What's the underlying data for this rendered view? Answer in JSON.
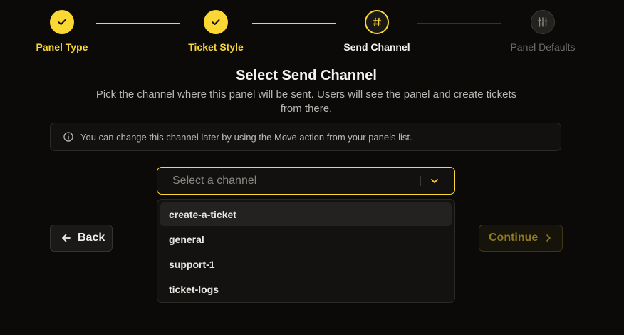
{
  "stepper": {
    "steps": [
      {
        "label": "Panel Type",
        "state": "done",
        "icon": "check-icon"
      },
      {
        "label": "Ticket Style",
        "state": "done",
        "icon": "check-icon"
      },
      {
        "label": "Send Channel",
        "state": "current",
        "icon": "hash-icon"
      },
      {
        "label": "Panel Defaults",
        "state": "todo",
        "icon": "sliders-icon"
      }
    ]
  },
  "main": {
    "title": "Select Send Channel",
    "subtitle": "Pick the channel where this panel will be sent. Users will see the panel and create tickets from there.",
    "info_text": "You can change this channel later by using the Move action from your panels list."
  },
  "channel_select": {
    "placeholder": "Select a channel",
    "options": [
      "create-a-ticket",
      "general",
      "support-1",
      "ticket-logs"
    ],
    "highlighted_index": 0
  },
  "footer": {
    "back_label": "Back",
    "continue_label": "Continue"
  },
  "colors": {
    "accent": "#fad733",
    "background": "#0b0a09"
  }
}
